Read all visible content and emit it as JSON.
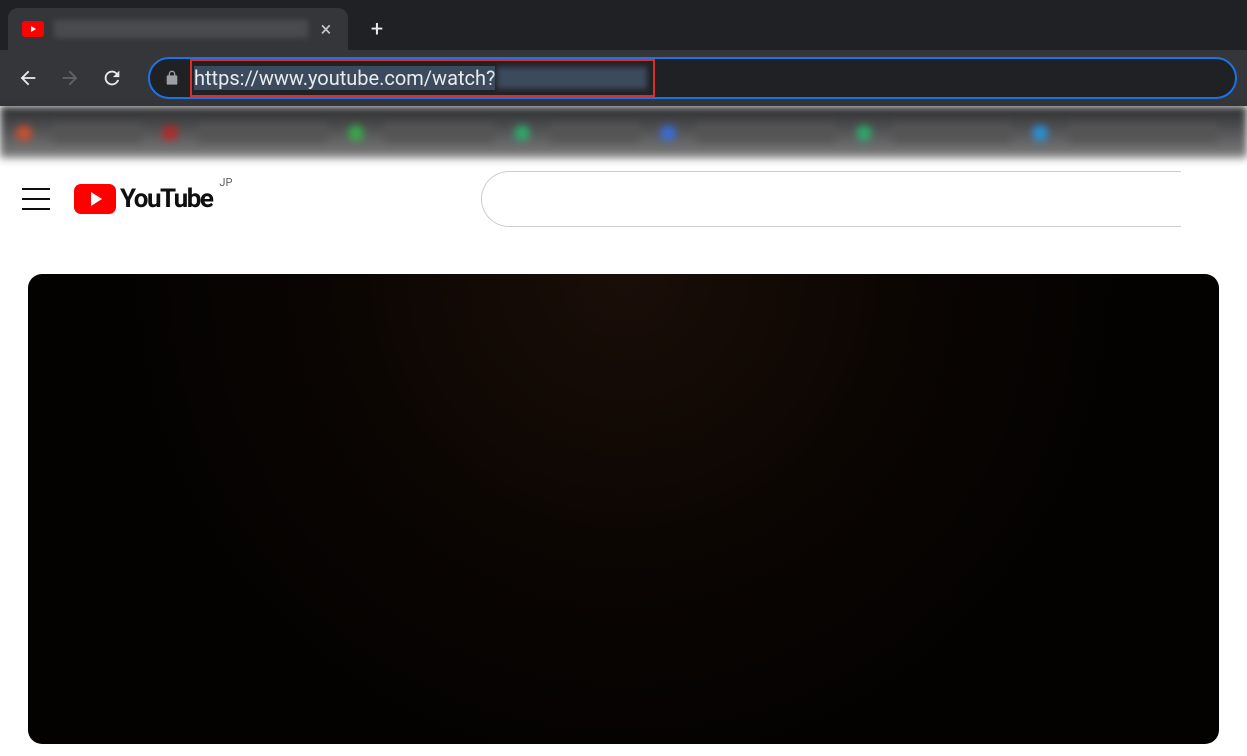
{
  "browser": {
    "url_visible": "https://www.youtube.com/watch?",
    "nav": {
      "back_enabled": true,
      "forward_enabled": false
    }
  },
  "youtube": {
    "logo_text": "YouTube",
    "region_code": "JP",
    "search_placeholder": ""
  }
}
